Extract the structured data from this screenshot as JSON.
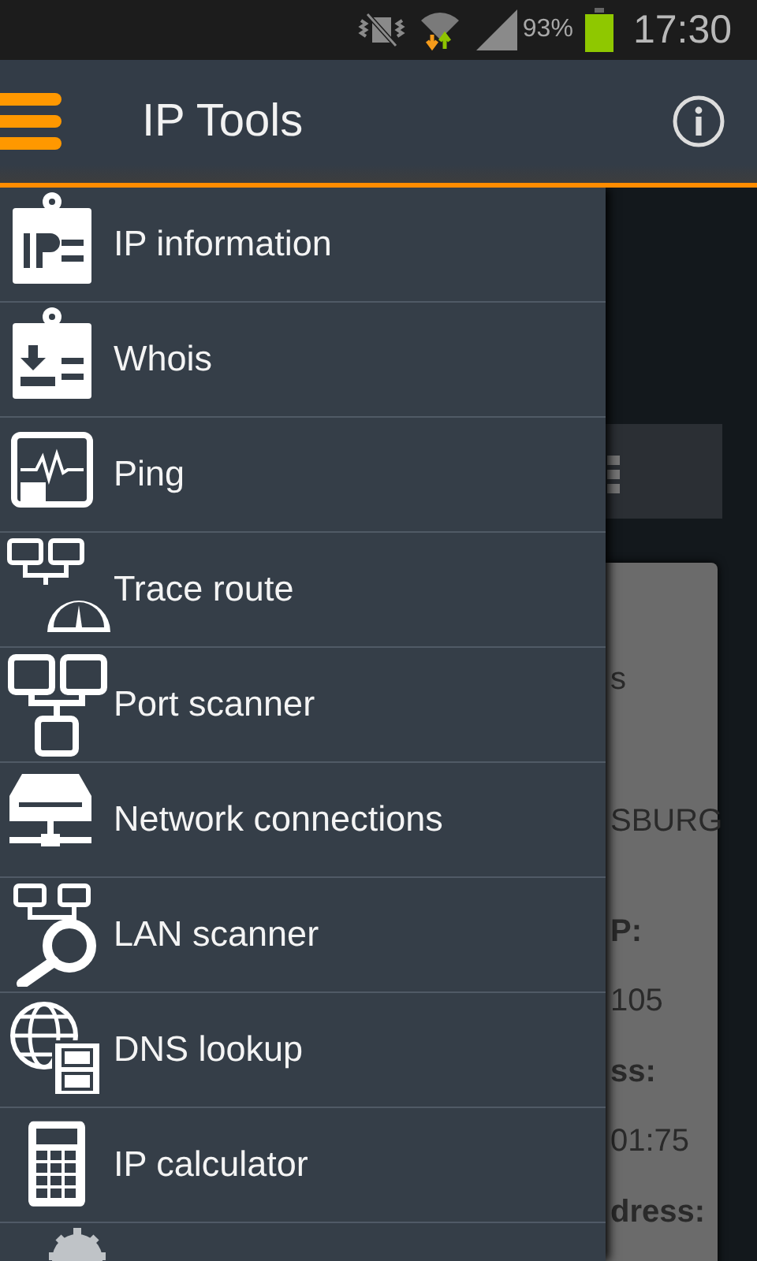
{
  "status_bar": {
    "battery_percent": "93%",
    "time": "17:30"
  },
  "app_bar": {
    "title": "IP Tools"
  },
  "drawer": {
    "items": [
      {
        "label": "IP information"
      },
      {
        "label": "Whois"
      },
      {
        "label": "Ping"
      },
      {
        "label": "Trace route"
      },
      {
        "label": "Port scanner"
      },
      {
        "label": "Network connections"
      },
      {
        "label": "LAN scanner"
      },
      {
        "label": "DNS lookup"
      },
      {
        "label": "IP calculator"
      }
    ]
  },
  "background_card": {
    "texts": [
      "s",
      "SBURG",
      "P:",
      "105",
      "ss:",
      "01:75",
      "dress:"
    ]
  }
}
